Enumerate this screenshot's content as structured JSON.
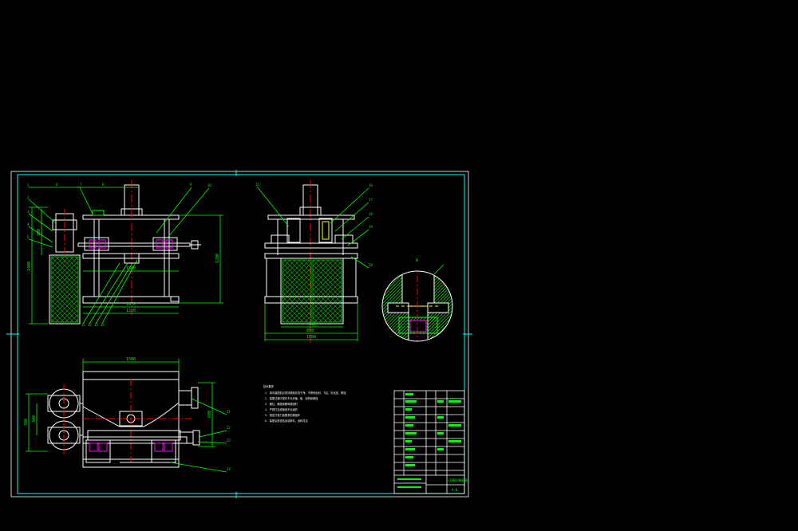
{
  "colors": {
    "background": "#000000",
    "frame": "#00ffff",
    "outline": "#ffffff",
    "dimension": "#00ff00",
    "centerline": "#ff0000",
    "hidden": "#ffff00",
    "hatch": "#00aa00",
    "accent": "#ff00ff"
  },
  "front_view": {
    "dim_texts": [
      "1500",
      "1470",
      "1470",
      "1220"
    ],
    "vertical_dims": [
      "390",
      "1400",
      "1200"
    ],
    "balloons": [
      "1",
      "2",
      "3",
      "4",
      "5",
      "6",
      "7",
      "8",
      "9",
      "10",
      "11",
      "12",
      "13",
      "14"
    ]
  },
  "side_view": {
    "dim_texts": [
      "700",
      "850",
      "1000"
    ],
    "balloons": [
      "15",
      "16",
      "17",
      "18",
      "19",
      "20"
    ]
  },
  "detail_view": {
    "label": "A"
  },
  "plan_view": {
    "dim_texts": [
      "1500",
      "380",
      "600",
      "340"
    ],
    "balloons": [
      "21",
      "22",
      "23",
      "24"
    ]
  },
  "notes": {
    "title": "技术要求",
    "lines": [
      "1. 零件装配前必须清理和清洗干净，不得有毛刺、飞边、氧化皮、锈蚀",
      "2. 装配过程中零件不允许磕、碰、划伤和锈蚀",
      "3. 螺钉、螺栓和螺母紧固时",
      "4. 严禁打击或使用不合适的",
      "5. 规定拧紧力矩要求的紧固件",
      "6. 装配后检查各运动部件，运转灵活"
    ]
  },
  "title_block": {
    "drawing_name": "压铸机装配图",
    "drawing_no": "A-0"
  }
}
